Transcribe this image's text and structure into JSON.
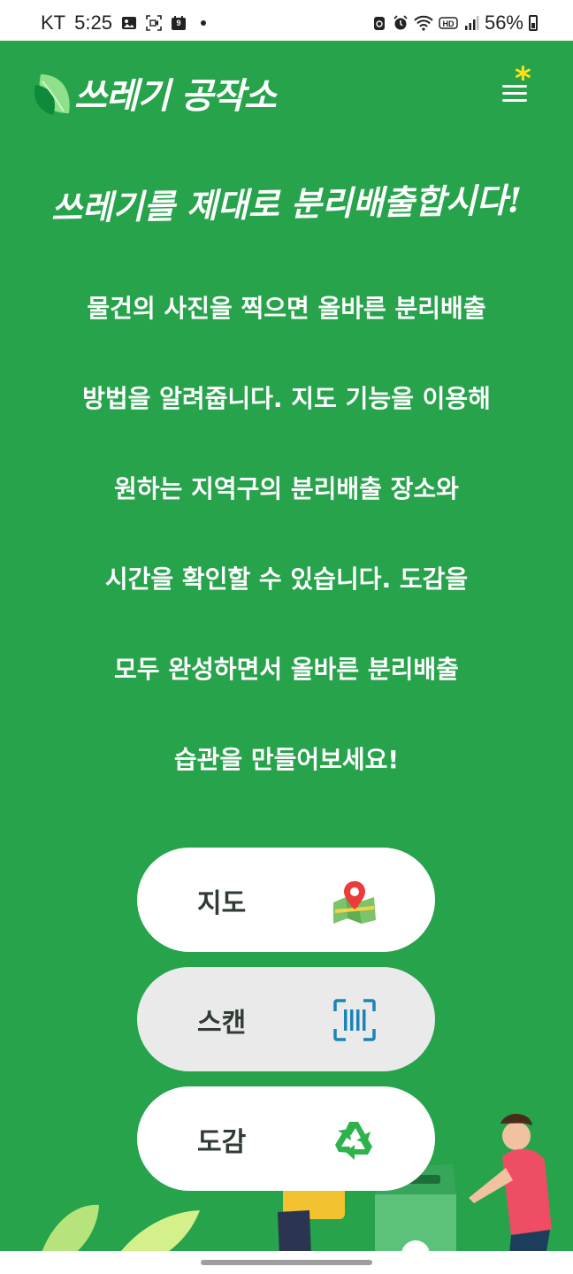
{
  "status": {
    "carrier": "KT",
    "time": "5:25",
    "notification_count": "9",
    "battery": "56%"
  },
  "header": {
    "app_title": "쓰레기 공작소"
  },
  "headline": "쓰레기를 제대로 분리배출합시다!",
  "description": [
    "물건의 사진을 찍으면 올바른 분리배출",
    "방법을 알려줍니다. 지도 기능을 이용해",
    "원하는 지역구의 분리배출 장소와",
    "시간을 확인할 수 있습니다. 도감을",
    "모두 완성하면서 올바른 분리배출",
    "습관을 만들어보세요!"
  ],
  "buttons": [
    {
      "label": "지도",
      "icon": "map-pin-icon"
    },
    {
      "label": "스캔",
      "icon": "barcode-scan-icon"
    },
    {
      "label": "도감",
      "icon": "recycle-icon"
    }
  ],
  "colors": {
    "background": "#26a34b",
    "menu_star": "#ffe11a",
    "button": "#ffffff",
    "button_pressed": "#eaeaea"
  }
}
